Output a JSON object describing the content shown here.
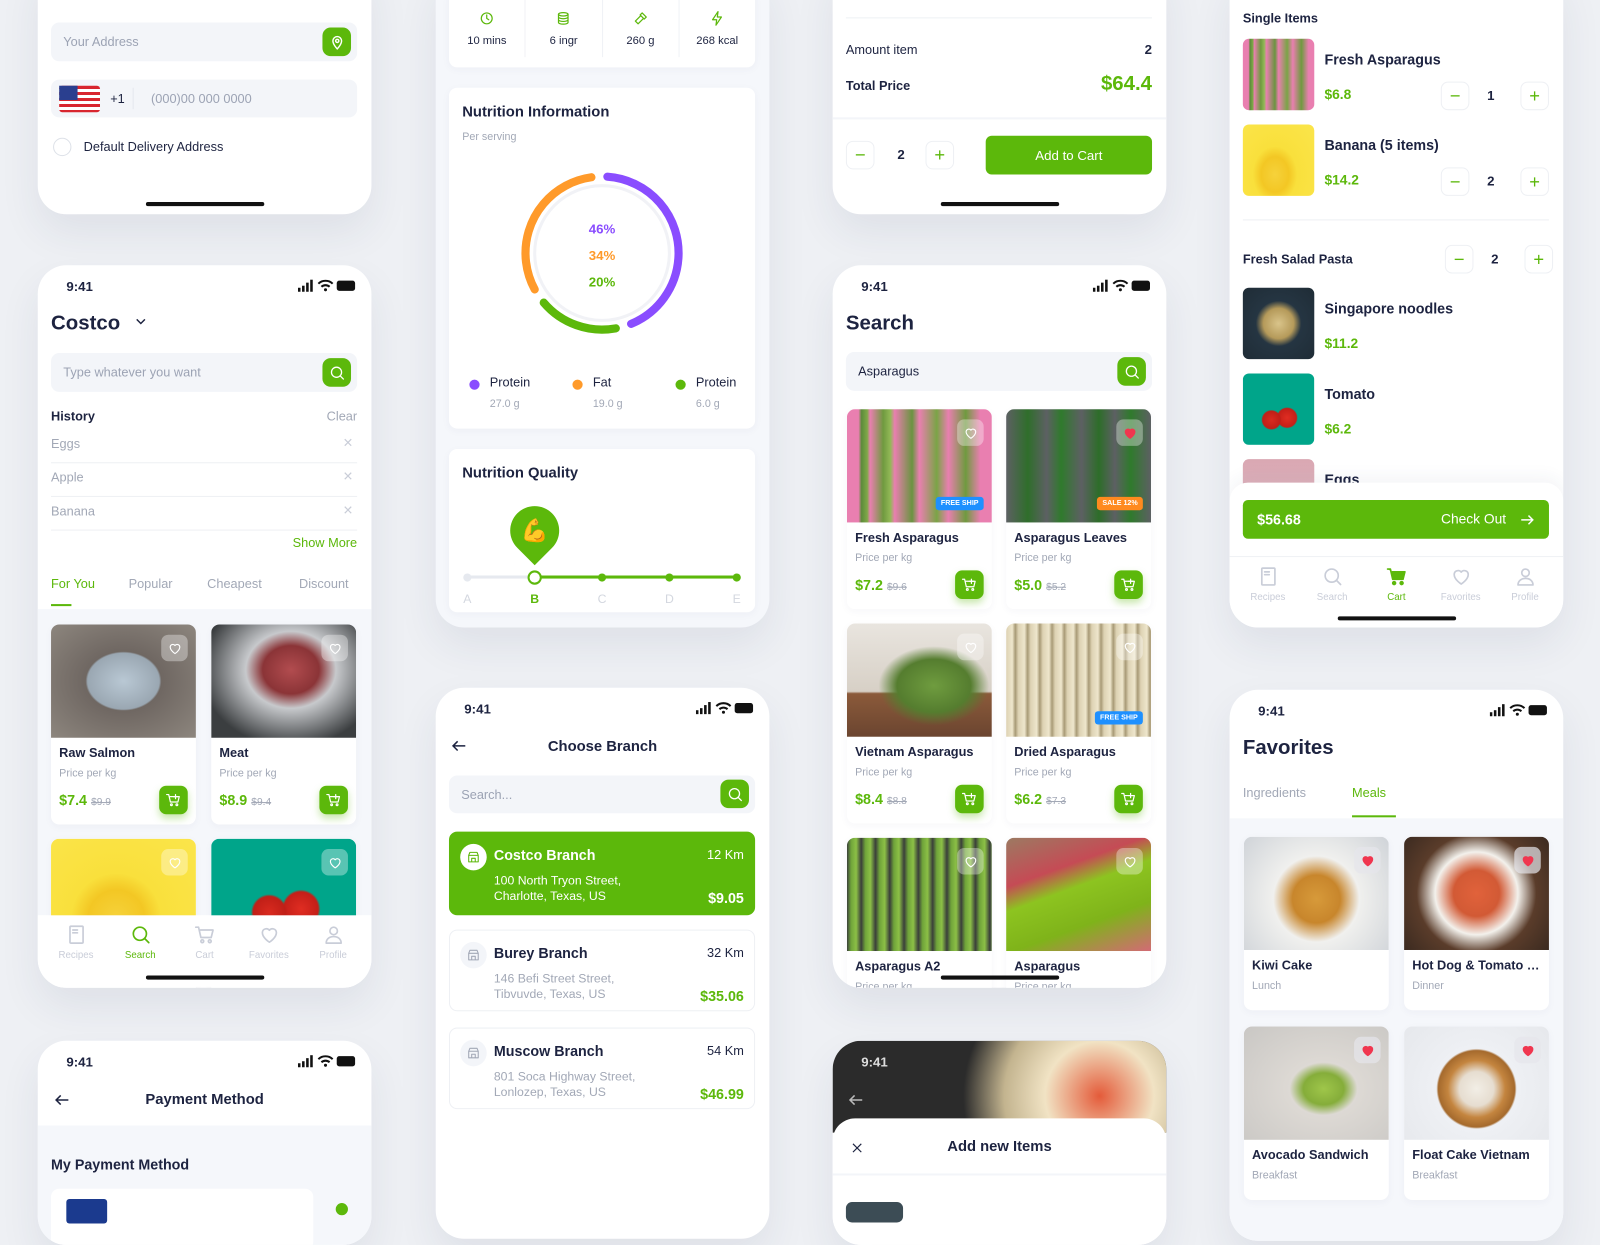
{
  "colors": {
    "accent": "#5cb80b",
    "text": "#1d2340",
    "muted": "#a2a8b6",
    "favorite": "#f0364f",
    "free_ship": "#1e90ff",
    "sale": "#ff8a1f",
    "protein": "#8a4dff",
    "fat": "#ff9a2a",
    "protein2": "#5cb80b"
  },
  "status": {
    "time": "9:41"
  },
  "address_form": {
    "address_placeholder": "Your Address",
    "country_code": "+1",
    "phone_placeholder": "(000)00 000 0000",
    "default_label": "Default Delivery Address"
  },
  "costco": {
    "store": "Costco",
    "search_placeholder": "Type whatever you want",
    "history_title": "History",
    "clear": "Clear",
    "history": [
      "Eggs",
      "Apple",
      "Banana"
    ],
    "show_more": "Show More",
    "tabs": [
      "For You",
      "Popular",
      "Cheapest",
      "Discount"
    ],
    "active_tab": "For You",
    "products": [
      {
        "name": "Raw Salmon",
        "unit": "Price per kg",
        "price": "$7.4",
        "old_price": "$9.9"
      },
      {
        "name": "Meat",
        "unit": "Price per kg",
        "price": "$8.9",
        "old_price": "$9.4"
      },
      {
        "name": "",
        "unit": "",
        "price": "",
        "old_price": ""
      },
      {
        "name": "",
        "unit": "",
        "price": "",
        "old_price": ""
      }
    ]
  },
  "nav": {
    "items": [
      "Recipes",
      "Search",
      "Cart",
      "Favorites",
      "Profile"
    ]
  },
  "payment": {
    "title": "Payment Method",
    "section": "My Payment Method"
  },
  "recipe": {
    "stats": [
      {
        "icon": "clock-icon",
        "label": "10 mins"
      },
      {
        "icon": "layers-icon",
        "label": "6 ingr"
      },
      {
        "icon": "hammer-icon",
        "label": "260 g"
      },
      {
        "icon": "bolt-icon",
        "label": "268 kcal"
      }
    ],
    "nutrition": {
      "title": "Nutrition Information",
      "subtitle": "Per serving",
      "segments": [
        {
          "percent": 46,
          "label": "46%",
          "color": "#8a4dff"
        },
        {
          "percent": 20,
          "label": "20%",
          "color": "#5cb80b"
        },
        {
          "percent": 34,
          "label": "34%",
          "color": "#ff9a2a"
        }
      ],
      "center_labels": [
        "46%",
        "34%",
        "20%"
      ],
      "legend": [
        {
          "name": "Protein",
          "value": "27.0 g",
          "color": "#8a4dff"
        },
        {
          "name": "Fat",
          "value": "19.0 g",
          "color": "#ff9a2a"
        },
        {
          "name": "Protein",
          "value": "6.0 g",
          "color": "#5cb80b"
        }
      ]
    },
    "quality": {
      "title": "Nutrition Quality",
      "grades": [
        "A",
        "B",
        "C",
        "D",
        "E"
      ],
      "selected": "B",
      "badge_icon": "flexed-biceps-icon"
    }
  },
  "branch": {
    "title": "Choose Branch",
    "search_placeholder": "Search...",
    "branches": [
      {
        "name": "Costco Branch",
        "distance": "12 Km",
        "address1": "100 North Tryon Street,",
        "address2": "Charlotte, Texas, US",
        "price": "$9.05",
        "selected": true
      },
      {
        "name": "Burey Branch",
        "distance": "32 Km",
        "address1": "146 Befi Street Street,",
        "address2": "Tibvuvde, Texas, US",
        "price": "$35.06",
        "selected": false
      },
      {
        "name": "Muscow Branch",
        "distance": "54 Km",
        "address1": "801 Soca Highway Street,",
        "address2": "Lonlozep, Texas, US",
        "price": "$46.99",
        "selected": false
      }
    ]
  },
  "product_detail": {
    "amount_label": "Amount item",
    "amount": "2",
    "total_label": "Total Price",
    "total": "$64.4",
    "qty": "2",
    "add_to_cart": "Add to Cart"
  },
  "search": {
    "title": "Search",
    "query": "Asparagus",
    "products": [
      {
        "name": "Fresh Asparagus",
        "unit": "Price per kg",
        "price": "$7.2",
        "old_price": "$9.6",
        "badge": "FREE SHIP",
        "favorite": false
      },
      {
        "name": "Asparagus Leaves",
        "unit": "Price per kg",
        "price": "$5.0",
        "old_price": "$5.2",
        "badge": "SALE 12%",
        "favorite": true
      },
      {
        "name": "Vietnam Asparagus",
        "unit": "Price per kg",
        "price": "$8.4",
        "old_price": "$8.8",
        "badge": "",
        "favorite": false
      },
      {
        "name": "Dried Asparagus",
        "unit": "Price per kg",
        "price": "$6.2",
        "old_price": "$7.3",
        "badge": "FREE SHIP",
        "favorite": false
      },
      {
        "name": "Asparagus A2",
        "unit": "Price per kg",
        "price": "",
        "old_price": "",
        "badge": "",
        "favorite": false
      },
      {
        "name": "Asparagus",
        "unit": "Price per kg",
        "price": "",
        "old_price": "",
        "badge": "",
        "favorite": false
      }
    ]
  },
  "add_items": {
    "title": "Add new Items"
  },
  "cart": {
    "single_title": "Single Items",
    "single_items": [
      {
        "name": "Fresh Asparagus",
        "price": "$6.8",
        "qty": "1"
      },
      {
        "name": "Banana (5 items)",
        "price": "$14.2",
        "qty": "2"
      }
    ],
    "group": {
      "name": "Fresh Salad Pasta",
      "qty": "2",
      "items": [
        {
          "name": "Singapore noodles",
          "price": "$11.2"
        },
        {
          "name": "Tomato",
          "price": "$6.2"
        },
        {
          "name": "Eggs",
          "price": ""
        }
      ]
    },
    "total": "$56.68",
    "checkout": "Check Out",
    "active_nav": "Cart"
  },
  "favorites": {
    "title": "Favorites",
    "tabs": [
      "Ingredients",
      "Meals"
    ],
    "active_tab": "Meals",
    "items": [
      {
        "name": "Kiwi Cake",
        "category": "Lunch"
      },
      {
        "name": "Hot Dog & Tomato S...",
        "category": "Dinner"
      },
      {
        "name": "Avocado Sandwich",
        "category": "Breakfast"
      },
      {
        "name": "Float Cake Vietnam",
        "category": "Breakfast"
      }
    ]
  }
}
